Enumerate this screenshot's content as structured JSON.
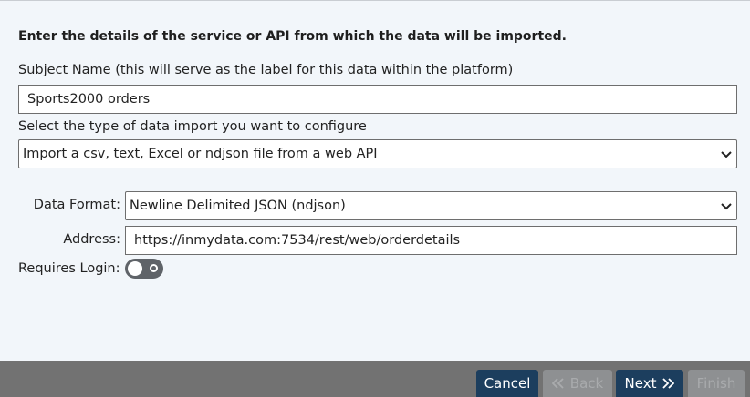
{
  "intro": "Enter the details of the service or API from which the data will be imported.",
  "subject": {
    "label": "Subject Name (this will serve as the label for this data within the platform)",
    "value": "Sports2000 orders"
  },
  "import_type": {
    "label": "Select the type of data import you want to configure",
    "value": "Import a csv, text, Excel or ndjson file from a web API"
  },
  "data_format": {
    "label": "Data Format:",
    "value": "Newline Delimited JSON (ndjson)"
  },
  "address": {
    "label": "Address:",
    "value": "https://inmydata.com:7534/rest/web/orderdetails"
  },
  "login": {
    "label": "Requires Login:",
    "enabled": false
  },
  "footer": {
    "cancel": "Cancel",
    "back": "Back",
    "next": "Next",
    "finish": "Finish"
  },
  "colors": {
    "background": "#f2f6fa",
    "footer": "#727272",
    "button_active": "#1c3e5e",
    "button_disabled": "#8e9092"
  }
}
